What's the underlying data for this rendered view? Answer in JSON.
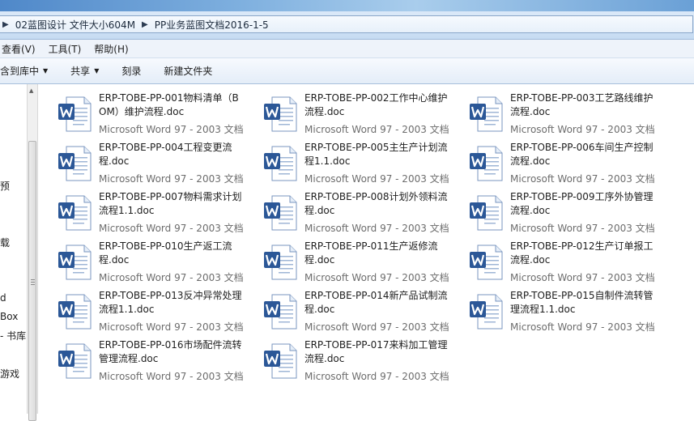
{
  "address": {
    "crumbs": [
      "02蓝图设计 文件大小604M",
      "PP业务蓝图文档2016-1-5"
    ],
    "separator": "▶"
  },
  "menu": {
    "items": [
      "查看(V)",
      "工具(T)",
      "帮助(H)"
    ]
  },
  "toolbar": {
    "include_in_library": "含到库中",
    "share": "共享",
    "burn": "刻录",
    "new_folder": "新建文件夹"
  },
  "nav_fragments": [
    "预",
    "载",
    "d",
    "Box",
    "- 书库",
    "游戏"
  ],
  "icons": {
    "word_doc": "word-document-icon",
    "dropdown": "chevron-down-icon"
  },
  "colors": {
    "word_blue": "#2b5797",
    "type_gray": "#6d6d6d"
  },
  "files": [
    {
      "name": "ERP-TOBE-PP-001物料清单（BOM）维护流程.doc",
      "type": "Microsoft Word 97 - 2003 文档"
    },
    {
      "name": "ERP-TOBE-PP-002工作中心维护流程.doc",
      "type": "Microsoft Word 97 - 2003 文档"
    },
    {
      "name": "ERP-TOBE-PP-003工艺路线维护流程.doc",
      "type": "Microsoft Word 97 - 2003 文档"
    },
    {
      "name": "ERP-TOBE-PP-004工程变更流程.doc",
      "type": "Microsoft Word 97 - 2003 文档"
    },
    {
      "name": "ERP-TOBE-PP-005主生产计划流程1.1.doc",
      "type": "Microsoft Word 97 - 2003 文档"
    },
    {
      "name": "ERP-TOBE-PP-006车间生产控制流程.doc",
      "type": "Microsoft Word 97 - 2003 文档"
    },
    {
      "name": "ERP-TOBE-PP-007物料需求计划流程1.1.doc",
      "type": "Microsoft Word 97 - 2003 文档"
    },
    {
      "name": "ERP-TOBE-PP-008计划外领料流程.doc",
      "type": "Microsoft Word 97 - 2003 文档"
    },
    {
      "name": "ERP-TOBE-PP-009工序外协管理流程.doc",
      "type": "Microsoft Word 97 - 2003 文档"
    },
    {
      "name": "ERP-TOBE-PP-010生产返工流程.doc",
      "type": "Microsoft Word 97 - 2003 文档"
    },
    {
      "name": "ERP-TOBE-PP-011生产返修流程.doc",
      "type": "Microsoft Word 97 - 2003 文档"
    },
    {
      "name": "ERP-TOBE-PP-012生产订单报工流程.doc",
      "type": "Microsoft Word 97 - 2003 文档"
    },
    {
      "name": "ERP-TOBE-PP-013反冲异常处理流程1.1.doc",
      "type": "Microsoft Word 97 - 2003 文档"
    },
    {
      "name": "ERP-TOBE-PP-014新产品试制流程.doc",
      "type": "Microsoft Word 97 - 2003 文档"
    },
    {
      "name": "ERP-TOBE-PP-015自制件流转管理流程1.1.doc",
      "type": "Microsoft Word 97 - 2003 文档"
    },
    {
      "name": "ERP-TOBE-PP-016市场配件流转管理流程.doc",
      "type": "Microsoft Word 97 - 2003 文档"
    },
    {
      "name": "ERP-TOBE-PP-017来料加工管理流程.doc",
      "type": "Microsoft Word 97 - 2003 文档"
    }
  ]
}
